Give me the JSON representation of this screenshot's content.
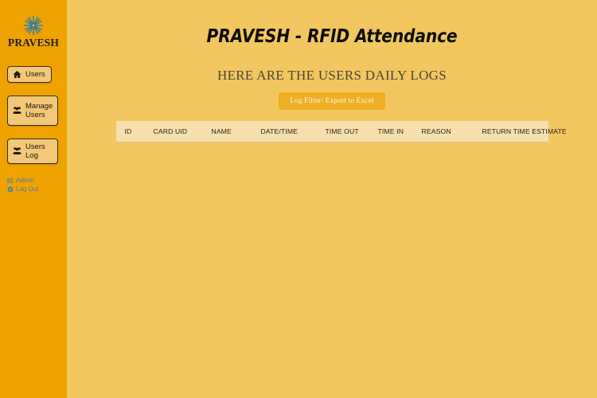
{
  "sidebar": {
    "brand": {
      "logo_icon": "snowflake-gear-logo-icon",
      "name": "PRAVESH"
    },
    "nav": [
      {
        "label": "Users",
        "icon": "home-icon",
        "two_line": false
      },
      {
        "label": "Manage Users",
        "icon": "users-group-icon",
        "two_line": true
      },
      {
        "label": "Users Log",
        "icon": "users-group-icon",
        "two_line": false
      }
    ],
    "links": [
      {
        "label": "Admin",
        "icon": "list-icon"
      },
      {
        "label": "Log Out",
        "icon": "power-icon"
      }
    ]
  },
  "main": {
    "title": "PRAVESH - RFID Attendance",
    "subtitle": "HERE ARE THE USERS DAILY LOGS",
    "filter_button": "Log Filter/ Export to Excel",
    "table": {
      "columns": [
        "ID",
        "CARD UID",
        "NAME",
        "DATE/TIME",
        "TIME OUT",
        "TIME IN",
        "REASON",
        "RETURN TIME ESTIMATE"
      ],
      "rows": []
    }
  },
  "colors": {
    "sidebar_bg": "#EFA200",
    "page_bg": "#F2C75F",
    "nav_button_bg": "#F2C777",
    "nav_button_border": "#3A2F10",
    "filter_button_bg": "#EFAE24",
    "table_header_bg": "#F5DFAC",
    "link_color": "#4F7FA8",
    "logo_accent": "#2E7FA8"
  }
}
